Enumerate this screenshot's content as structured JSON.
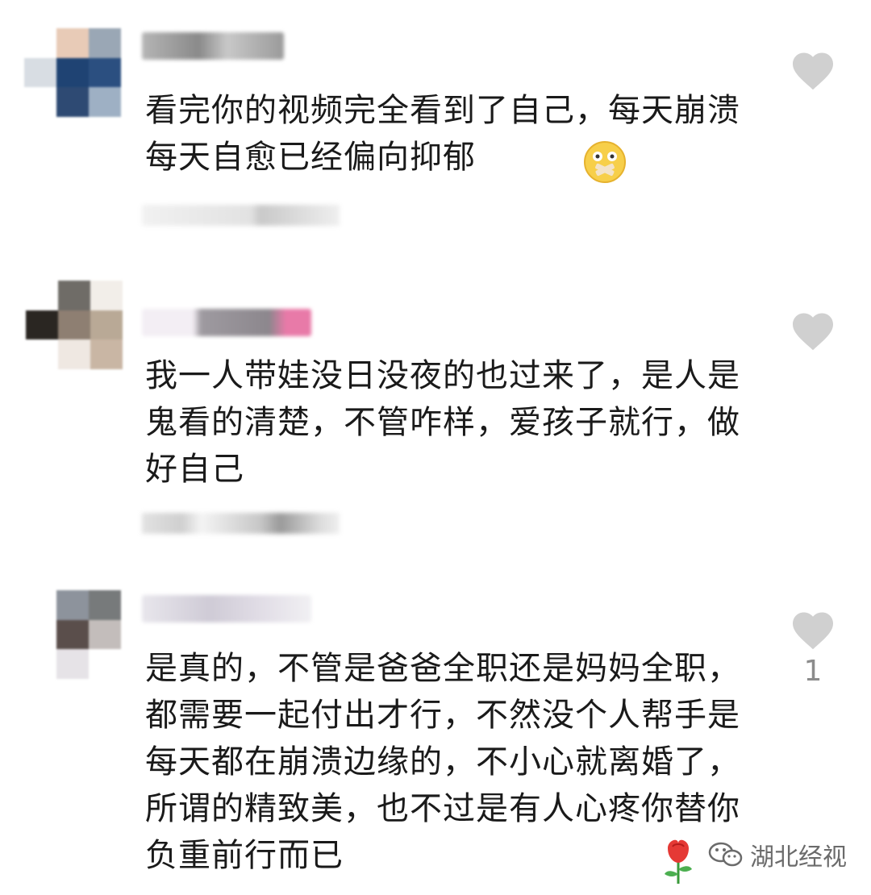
{
  "comments": [
    {
      "text": "看完你的视频完全看到了自己，每天崩溃每天自愈已经偏向抑郁",
      "emoji": "face-with-bandage-mouth-emoji",
      "likes": ""
    },
    {
      "text": "我一人带娃没日没夜的也过来了，是人是鬼看的清楚，不管咋样，爱孩子就行，做好自己",
      "likes": ""
    },
    {
      "text": "是真的，不管是爸爸全职还是妈妈全职，都需要一起付出才行，不然没个人帮手是每天都在崩溃边缘的，不小心就离婚了，所谓的精致美，也不过是有人心疼你替你负重前行而已",
      "emoji": "rose-emoji",
      "likes": "1"
    }
  ],
  "watermark": {
    "label": "湖北经视",
    "icon": "wechat-icon"
  },
  "colors": {
    "text": "#1a1a1a",
    "heart": "#d0d0d0",
    "count": "#8c8c8c"
  }
}
